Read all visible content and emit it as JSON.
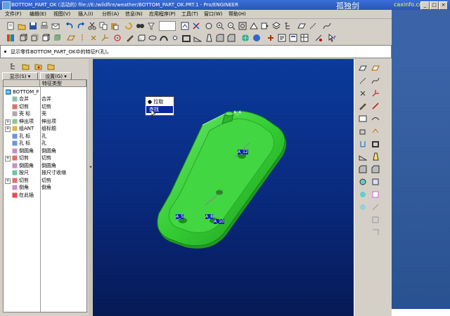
{
  "window": {
    "title": "BOTTOM_PART_OK (活动的) file://E:/wildfire/weather/BOTTOM_PART_OK.PRT.1 - Pro/ENGINEER",
    "watermark": "孤独剑",
    "watermark2": "caxinfo.com",
    "min_label": "_",
    "max_label": "□",
    "close_label": "×"
  },
  "menubar": {
    "items": [
      "文件(F)",
      "编辑(E)",
      "视图(V)",
      "插入(I)",
      "分析(A)",
      "信息(N)",
      "应用程序(P)",
      "工具(T)",
      "窗口(W)",
      "帮助(H)"
    ]
  },
  "message": {
    "text": "显示零件BOTTOM_PART_OK中的特征F(孔)。"
  },
  "leftpanel": {
    "show_label": "显示(S) ▾",
    "settings_label": "设置(G) ▾"
  },
  "tree": {
    "col_name": "",
    "col_type": "特征类型",
    "root": "BOTTOM_PA",
    "rows": [
      {
        "expander": "",
        "name": "合并",
        "type": "合并"
      },
      {
        "expander": "",
        "name": "切剪",
        "type": "切剪"
      },
      {
        "expander": "",
        "name": "壳 标",
        "type": "壳"
      },
      {
        "expander": "+",
        "name": "伸出项",
        "type": "伸出项"
      },
      {
        "expander": "+",
        "name": "组ANT",
        "type": "组标题"
      },
      {
        "expander": "",
        "name": "孔 标",
        "type": "孔"
      },
      {
        "expander": "",
        "name": "孔 标",
        "type": "孔"
      },
      {
        "expander": "",
        "name": "倒圆角",
        "type": "倒圆角"
      },
      {
        "expander": "+",
        "name": "切剪",
        "type": "切剪"
      },
      {
        "expander": "",
        "name": "倒圆角",
        "type": "倒圆角"
      },
      {
        "expander": "",
        "name": "按尺",
        "type": "按尺寸收缩"
      },
      {
        "expander": "+",
        "name": "切剪",
        "type": "切剪"
      },
      {
        "expander": "",
        "name": "倒角",
        "type": "倒角"
      },
      {
        "expander": "",
        "name": "在此插",
        "type": ""
      }
    ]
  },
  "popup": {
    "item1": "拉取",
    "item2": "查找"
  },
  "model_labels": {
    "top": "A_4",
    "hole1": "A_12",
    "hole2": "A_5",
    "hole3": "A_8",
    "hole4": "A_10"
  },
  "colors": {
    "part": "#33cc33",
    "viewport_top": "#0a3a9c",
    "title_bar": "#2a55b8"
  }
}
